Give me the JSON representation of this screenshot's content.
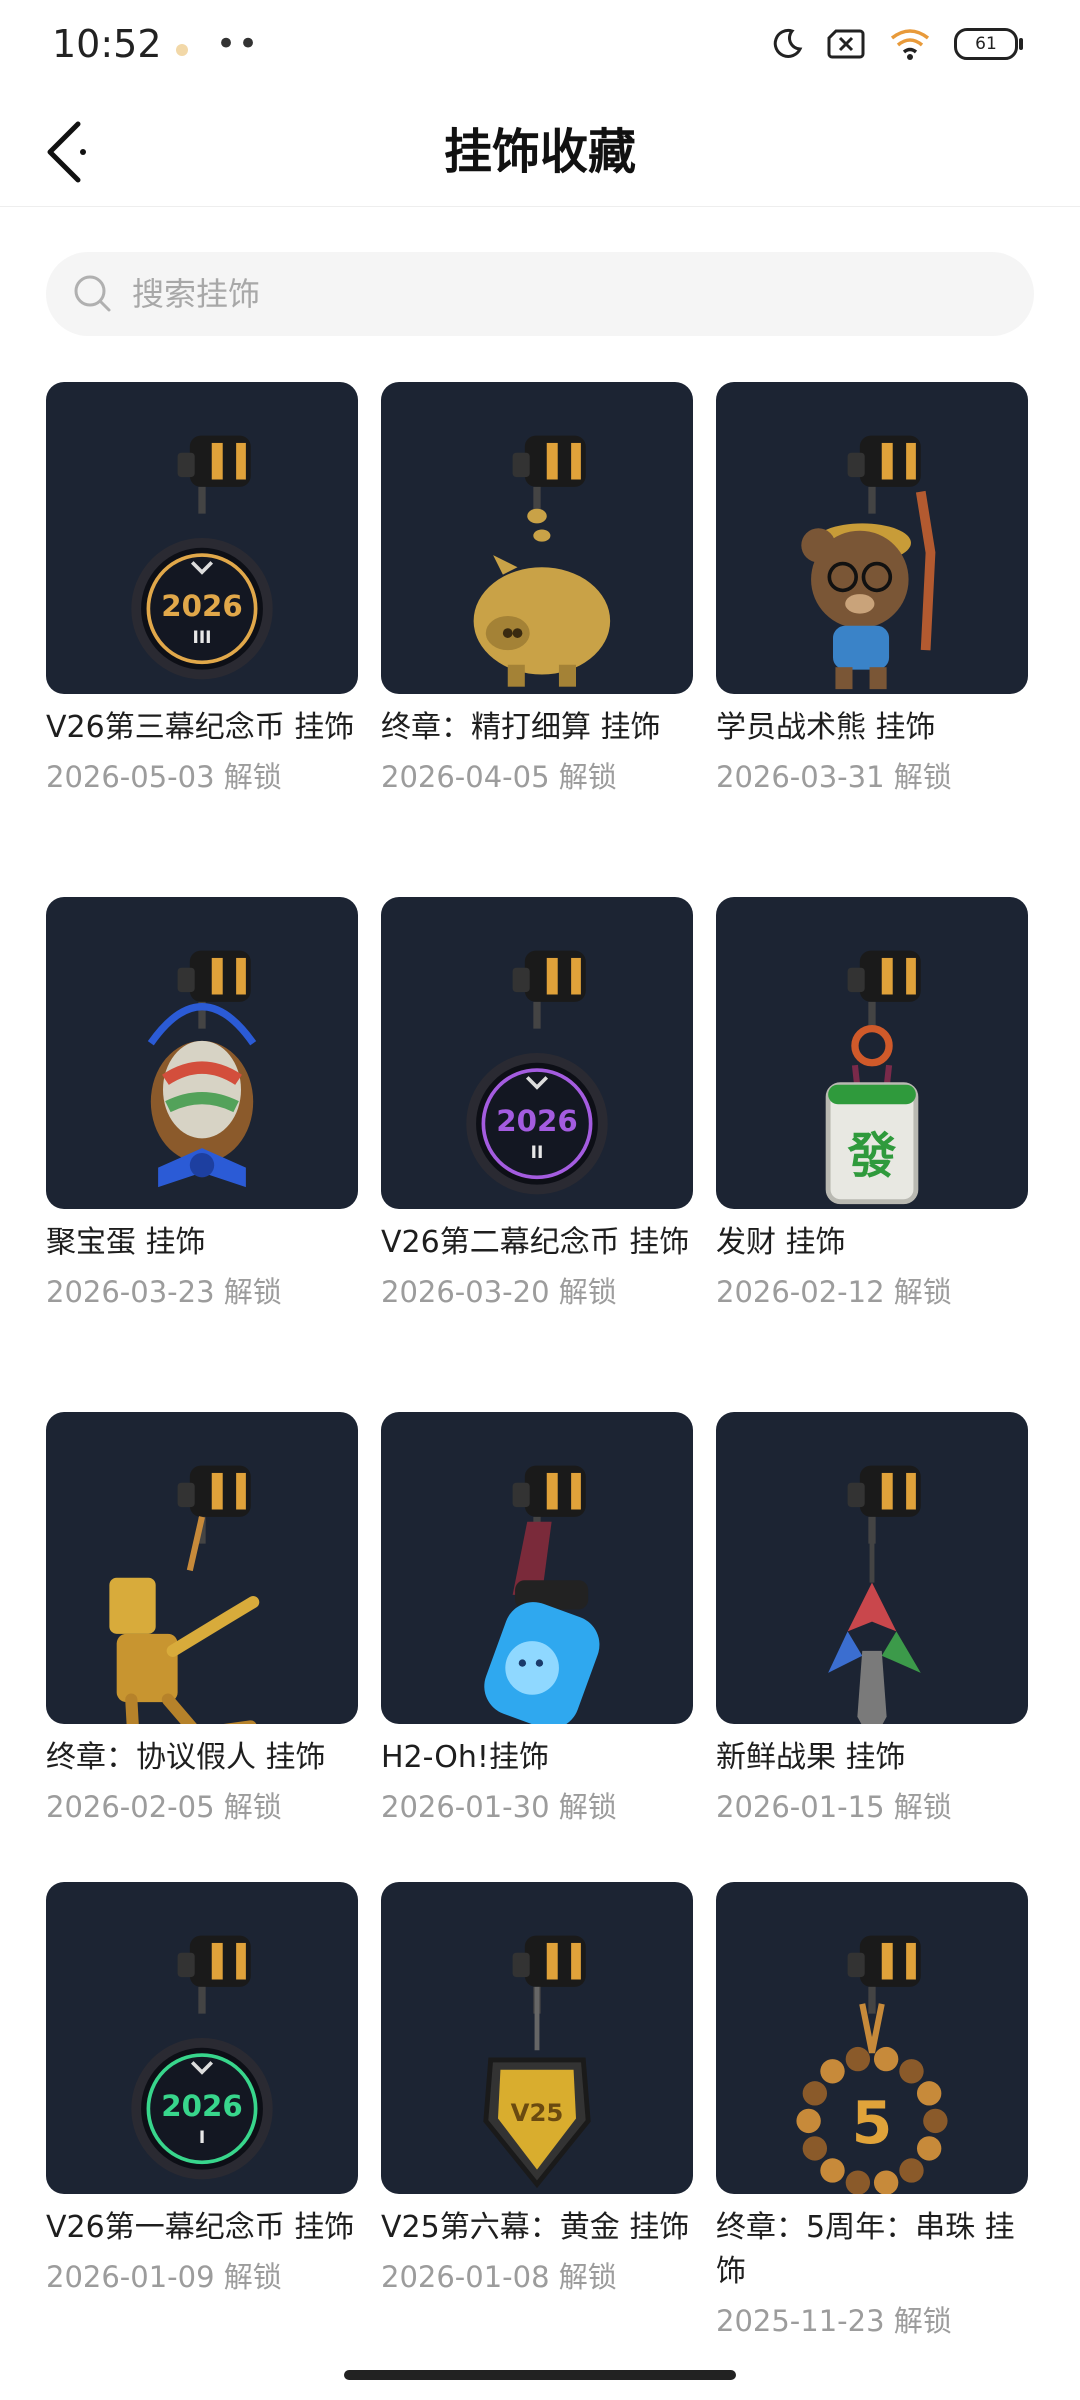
{
  "status_bar": {
    "time": "10:52",
    "dots": "••",
    "battery": "61"
  },
  "header": {
    "title": "挂饰收藏"
  },
  "search": {
    "placeholder": "搜索挂饰"
  },
  "items": [
    {
      "name": "V26第三幕纪念币 挂饰",
      "date": "2026-05-03 解锁",
      "art": "coin",
      "accent": "#e1a84a",
      "label": "2026",
      "sub": "III"
    },
    {
      "name": "终章：精打细算 挂饰",
      "date": "2026-04-05 解锁",
      "art": "pig",
      "accent": "#c9a247"
    },
    {
      "name": "学员战术熊 挂饰",
      "date": "2026-03-31 解锁",
      "art": "bear",
      "accent": "#7a5636"
    },
    {
      "name": "聚宝蛋 挂饰",
      "date": "2026-03-23 解锁",
      "art": "egg",
      "accent": "#2b5bd6"
    },
    {
      "name": "V26第二幕纪念币 挂饰",
      "date": "2026-03-20 解锁",
      "art": "coin",
      "accent": "#a45ce0",
      "label": "2026",
      "sub": "II"
    },
    {
      "name": "发财 挂饰",
      "date": "2026-02-12 解锁",
      "art": "mahjong",
      "accent": "#2f9a3c",
      "label": "發"
    },
    {
      "name": "终章：协议假人 挂饰",
      "date": "2026-02-05 解锁",
      "art": "dummy",
      "accent": "#d8ab3b"
    },
    {
      "name": "H2-Oh!挂饰",
      "date": "2026-01-30 解锁",
      "art": "bottle",
      "accent": "#2fa8ef"
    },
    {
      "name": "新鲜战果 挂饰",
      "date": "2026-01-15 解锁",
      "art": "fruit",
      "accent": "#c9474c"
    },
    {
      "name": "V26第一幕纪念币 挂饰",
      "date": "2026-01-09 解锁",
      "art": "coin",
      "accent": "#38d68c",
      "label": "2026",
      "sub": "I"
    },
    {
      "name": "V25第六幕：黄金 挂饰",
      "date": "2026-01-08 解锁",
      "art": "shield",
      "accent": "#d9ad2e",
      "label": "V25"
    },
    {
      "name": "终章：5周年：串珠 挂饰",
      "date": "2025-11-23 解锁",
      "art": "beads",
      "accent": "#c78a3a",
      "label": "5"
    }
  ]
}
